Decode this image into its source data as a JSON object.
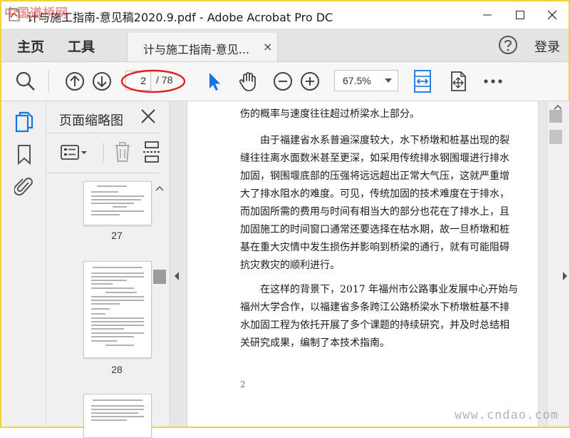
{
  "watermarks": {
    "top_left": "中国道桥网",
    "bottom_right": "www.cndao.com"
  },
  "window": {
    "title": "计与施工指南-意见稿2020.9.pdf - Adobe Acrobat Pro DC"
  },
  "tabs": {
    "home": "主页",
    "tools": "工具",
    "document": "计与施工指南-意见...",
    "close": "×",
    "login": "登录"
  },
  "toolbar": {
    "page_current": "2",
    "page_total": "/ 78",
    "zoom": "67.5%"
  },
  "thumbnail_panel": {
    "title": "页面缩略图",
    "pages": [
      {
        "number": "27"
      },
      {
        "number": "28"
      }
    ]
  },
  "document": {
    "lines": [
      "伤的概率与速度往往超过桥梁水上部分。",
      "由于福建省水系普遍深度较大，水下桥墩和桩基出现的裂",
      "缝往往离水面数米甚至更深，如采用传统排水钢围堰进行排水",
      "加固，钢围堰底部的压强将远远超出正常大气压，这就严重增",
      "大了排水阻水的难度。可见，传统加固的技术难度在于排水，",
      "而加固所需的费用与时间有相当大的部分也花在了排水上，且",
      "加固施工的时间窗口通常还要选择在枯水期，故一旦桥墩和桩",
      "基在重大灾情中发生损伤并影响到桥梁的通行，就有可能阻碍",
      "抗灾救灾的顺利进行。",
      "在这样的背景下，2017 年福州市公路事业发展中心开始与",
      "福州大学合作，以福建省多条跨江公路桥梁水下桥墩桩基不排",
      "水加固工程为依托开展了多个课题的持续研究，并及时总结相",
      "关研究成果，编制了本技术指南。"
    ],
    "page_number": "2"
  },
  "colors": {
    "accent_blue": "#1473e6",
    "annotation_red": "#e02020",
    "page_bg": "#ffffff",
    "chrome_bg": "#f0f0f0"
  }
}
